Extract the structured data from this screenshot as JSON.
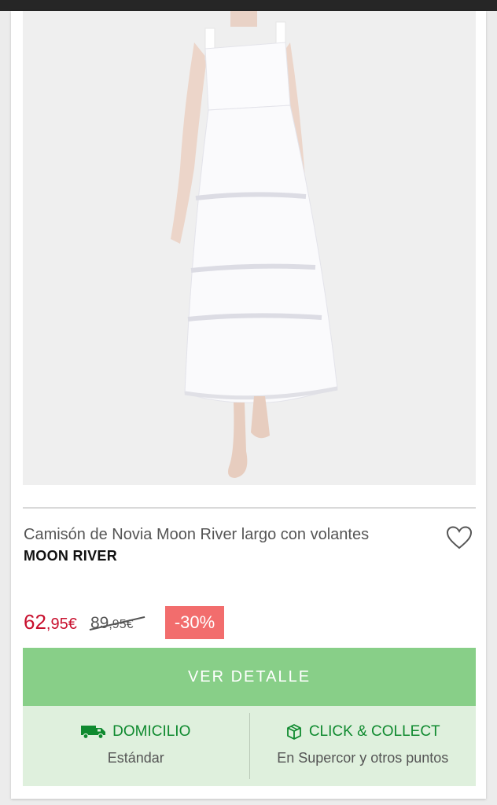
{
  "product": {
    "title": "Camisón de Novia Moon River largo con volantes",
    "brand": "MOON RIVER"
  },
  "price": {
    "current_int": "62",
    "current_dec": ",95€",
    "old_int": "89",
    "old_dec": ",95€",
    "discount": "-30%"
  },
  "cta": {
    "label": "VER DETALLE"
  },
  "delivery": {
    "home": {
      "label": "DOMICILIO",
      "sub": "Estándar",
      "icon": "truck-icon"
    },
    "click": {
      "label": "CLICK & COLLECT",
      "sub": "En Supercor y otros puntos",
      "icon": "box-icon"
    }
  },
  "colors": {
    "price": "#c8102e",
    "discount_bg": "#f26d6d",
    "cta_bg": "#88cf88",
    "delivery_bg": "#dff0dd",
    "delivery_text": "#0f8a2f"
  }
}
